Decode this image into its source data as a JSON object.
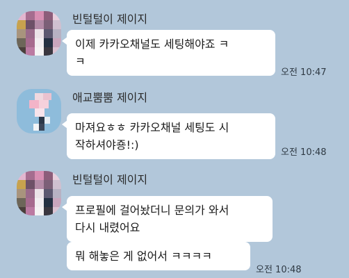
{
  "messages": [
    {
      "sender": "빈털털이 제이지",
      "bubbles": [
        {
          "text": "이제 카카오채널도 세팅해야죠 ㅋ\nㅋ"
        }
      ],
      "time": "오전 10:47"
    },
    {
      "sender": "애교뿜뿜 제이지",
      "bubbles": [
        {
          "text": "마져요ㅎㅎ 카카오채널 세팅도 시\n작하셔야죵!:)"
        }
      ],
      "time": "오전 10:48"
    },
    {
      "sender": "빈털털이 제이지",
      "bubbles": [
        {
          "text": "프로필에 걸어놨더니 문의가 와서\n다시 내렸어요"
        },
        {
          "text": "뭐 해놓은 게 없어서 ㅋㅋㅋㅋ"
        }
      ],
      "time": "오전 10:48"
    }
  ],
  "colors": {
    "background": "#b2c7da",
    "bubble": "#ffffff"
  }
}
